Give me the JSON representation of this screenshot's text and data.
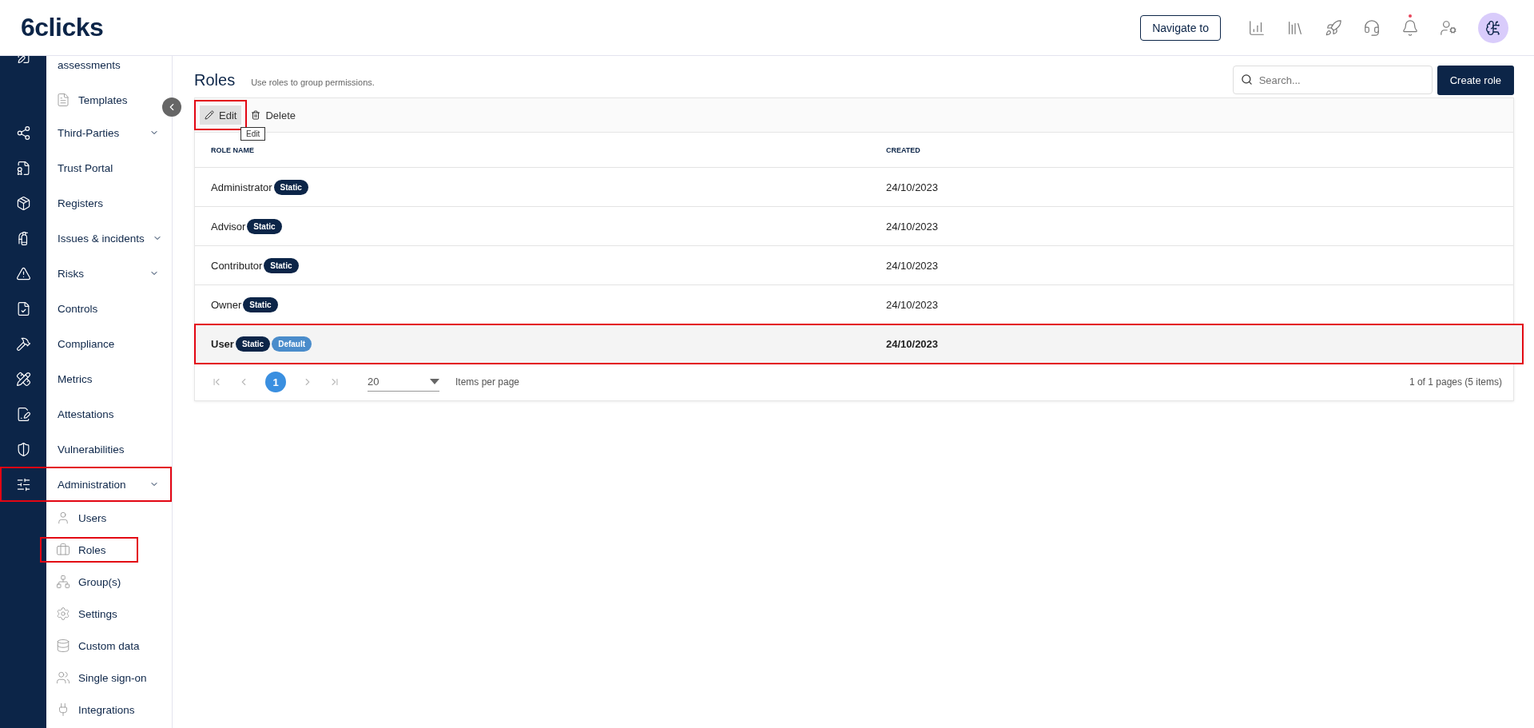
{
  "header": {
    "logo": "6clicks",
    "navigate_button": "Navigate to",
    "notification": true
  },
  "sidebar": {
    "items": [
      {
        "label": "assessments",
        "kind": "group",
        "expandable": false,
        "highlighted": false
      },
      {
        "label": "Templates",
        "kind": "sub",
        "expandable": false,
        "highlighted": false
      },
      {
        "label": "Third-Parties",
        "kind": "group",
        "expandable": true,
        "highlighted": false
      },
      {
        "label": "Trust Portal",
        "kind": "group",
        "expandable": false,
        "highlighted": false
      },
      {
        "label": "Registers",
        "kind": "group",
        "expandable": false,
        "highlighted": false
      },
      {
        "label": "Issues & incidents",
        "kind": "group",
        "expandable": true,
        "highlighted": false
      },
      {
        "label": "Risks",
        "kind": "group",
        "expandable": true,
        "highlighted": false
      },
      {
        "label": "Controls",
        "kind": "group",
        "expandable": false,
        "highlighted": false
      },
      {
        "label": "Compliance",
        "kind": "group",
        "expandable": false,
        "highlighted": false
      },
      {
        "label": "Metrics",
        "kind": "group",
        "expandable": false,
        "highlighted": false
      },
      {
        "label": "Attestations",
        "kind": "group",
        "expandable": false,
        "highlighted": false
      },
      {
        "label": "Vulnerabilities",
        "kind": "group",
        "expandable": false,
        "highlighted": false
      },
      {
        "label": "Administration",
        "kind": "group",
        "expandable": true,
        "highlighted": true
      },
      {
        "label": "Users",
        "kind": "sub",
        "expandable": false,
        "highlighted": false
      },
      {
        "label": "Roles",
        "kind": "sub",
        "expandable": false,
        "highlighted": true
      },
      {
        "label": "Group(s)",
        "kind": "sub",
        "expandable": false,
        "highlighted": false
      },
      {
        "label": "Settings",
        "kind": "sub",
        "expandable": false,
        "highlighted": false
      },
      {
        "label": "Custom data",
        "kind": "sub",
        "expandable": false,
        "highlighted": false
      },
      {
        "label": "Single sign-on",
        "kind": "sub",
        "expandable": false,
        "highlighted": false
      },
      {
        "label": "Integrations",
        "kind": "sub",
        "expandable": false,
        "highlighted": false
      }
    ]
  },
  "page": {
    "title": "Roles",
    "subtitle": "Use roles to group permissions.",
    "search": {
      "placeholder": "Search..."
    },
    "create_button": "Create role"
  },
  "toolbar": {
    "actions": [
      {
        "label": "Edit",
        "kind": "edit",
        "hovered": true,
        "highlighted": true
      },
      {
        "label": "Delete",
        "kind": "delete",
        "hovered": false,
        "highlighted": false
      }
    ],
    "tooltip": "Edit"
  },
  "table": {
    "columns": [
      "ROLE NAME",
      "CREATED"
    ],
    "rows": [
      {
        "name": "Administrator",
        "tags": [
          {
            "label": "Static",
            "kind": "static"
          }
        ],
        "created": "24/10/2023",
        "selected": false,
        "highlighted": false
      },
      {
        "name": "Advisor",
        "tags": [
          {
            "label": "Static",
            "kind": "static"
          }
        ],
        "created": "24/10/2023",
        "selected": false,
        "highlighted": false
      },
      {
        "name": "Contributor",
        "tags": [
          {
            "label": "Static",
            "kind": "static"
          }
        ],
        "created": "24/10/2023",
        "selected": false,
        "highlighted": false
      },
      {
        "name": "Owner",
        "tags": [
          {
            "label": "Static",
            "kind": "static"
          }
        ],
        "created": "24/10/2023",
        "selected": false,
        "highlighted": false
      },
      {
        "name": "User",
        "tags": [
          {
            "label": "Static",
            "kind": "static"
          },
          {
            "label": "Default",
            "kind": "default"
          }
        ],
        "created": "24/10/2023",
        "selected": true,
        "highlighted": true
      }
    ]
  },
  "pagination": {
    "page": "1",
    "page_size": "20",
    "page_size_label": "Items per page",
    "summary": "1 of 1 pages (5 items)"
  }
}
